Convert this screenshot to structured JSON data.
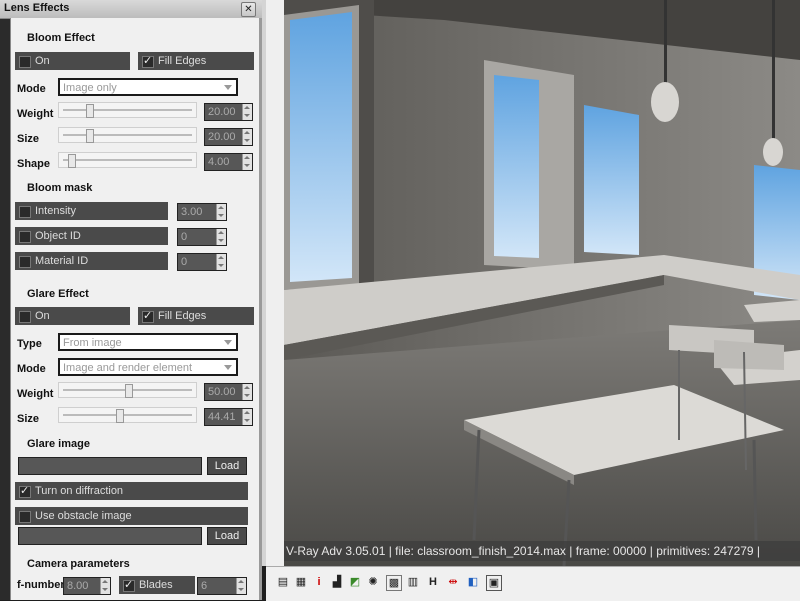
{
  "window": {
    "title": "Lens Effects",
    "close_glyph": "✕"
  },
  "bloom": {
    "section": "Bloom Effect",
    "on_label": "On",
    "on_checked": false,
    "fill_edges_label": "Fill Edges",
    "fill_edges_checked": true,
    "mode_label": "Mode",
    "mode_value": "Image only",
    "weight_label": "Weight",
    "weight_value": "20.00",
    "size_label": "Size",
    "size_value": "20.00",
    "shape_label": "Shape",
    "shape_value": "4.00"
  },
  "bloom_mask": {
    "section": "Bloom mask",
    "intensity_label": "Intensity",
    "intensity_value": "3.00",
    "object_id_label": "Object ID",
    "object_id_value": "0",
    "material_id_label": "Material ID",
    "material_id_value": "0"
  },
  "glare": {
    "section": "Glare Effect",
    "on_label": "On",
    "on_checked": false,
    "fill_edges_label": "Fill Edges",
    "fill_edges_checked": true,
    "type_label": "Type",
    "type_value": "From image",
    "mode_label": "Mode",
    "mode_value": "Image and render element",
    "weight_label": "Weight",
    "weight_value": "50.00",
    "size_label": "Size",
    "size_value": "44.41"
  },
  "glare_image": {
    "section": "Glare image",
    "load_label": "Load",
    "diffraction_label": "Turn on diffraction",
    "diffraction_checked": true,
    "obstacle_label": "Use obstacle image",
    "obstacle_checked": false,
    "load2_label": "Load"
  },
  "camera": {
    "section": "Camera parameters",
    "fnumber_label": "f-number",
    "fnumber_value": "8.00",
    "blades_label": "Blades",
    "blades_checked": true,
    "blades_value": "6"
  },
  "render": {
    "status": "V-Ray Adv 3.05.01 | file: classroom_finish_2014.max | frame: 00000 | primitives: 247279 |"
  },
  "toolbar_icons": [
    "layers-icon",
    "film-strip-icon",
    "info-icon",
    "histogram-icon",
    "color-correction-icon",
    "lens-icon",
    "region-icon",
    "history-icon",
    "h-icon",
    "stereo-icon",
    "compare-icon",
    "grid-icon"
  ]
}
